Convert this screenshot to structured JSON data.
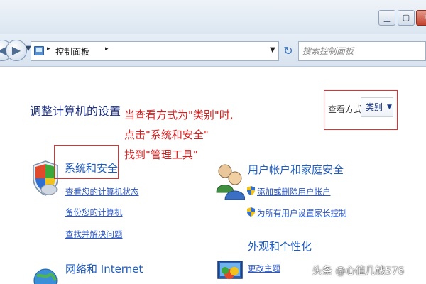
{
  "window": {
    "minimize_glyph": "▁",
    "maximize_glyph": "▢",
    "close_glyph": "✕"
  },
  "address_bar": {
    "back_glyph": "◀",
    "forward_glyph": "▶",
    "breadcrumb_separator": "▸",
    "breadcrumb": "控制面板",
    "dropdown_glyph": "▼",
    "refresh_glyph": "↻",
    "search_placeholder": "搜索控制面板"
  },
  "header": {
    "title": "调整计算机的设置",
    "view_by_label": "查看方式:",
    "view_by_value": "类别",
    "view_by_arrow": "▼"
  },
  "annotation": {
    "text": "当查看方式为\"类别\"时,\n点击\"系统和安全\"\n找到\"管理工具\"",
    "color": "#d42020"
  },
  "categories": {
    "security": {
      "icon": "shield-icon",
      "title": "系统和安全",
      "links": [
        "查看您的计算机状态",
        "备份您的计算机",
        "查找并解决问题"
      ]
    },
    "users": {
      "icon": "users-icon",
      "title": "用户帐户和家庭安全",
      "links": [
        "添加或删除用户帐户",
        "为所有用户设置家长控制"
      ]
    },
    "network": {
      "icon": "network-icon",
      "title": "网络和 Internet"
    },
    "appearance": {
      "icon": "display-icon",
      "title": "外观和个性化",
      "links": [
        "更改主题"
      ]
    }
  },
  "watermark": "头条 @心值几钱576",
  "colors": {
    "link": "#2b57c3",
    "category_title": "#1e5cc0",
    "page_title": "#1e3287",
    "highlight_frame": "#e03030"
  }
}
